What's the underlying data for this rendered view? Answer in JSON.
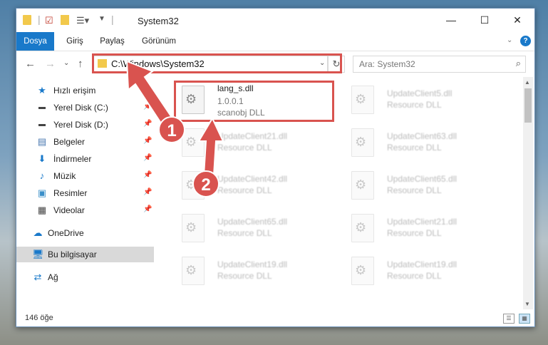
{
  "window": {
    "title": "System32",
    "controls": {
      "minimize": "—",
      "maximize": "☐",
      "close": "✕"
    }
  },
  "ribbon": {
    "tabs": [
      "Dosya",
      "Giriş",
      "Paylaş",
      "Görünüm"
    ]
  },
  "nav": {
    "address": "C:\\Windows\\System32",
    "search_placeholder": "Ara: System32"
  },
  "sidebar": {
    "items": [
      {
        "label": "Hızlı erişim",
        "icon": "star-icon",
        "pinned": false
      },
      {
        "label": "Yerel Disk (C:)",
        "icon": "drive-icon",
        "pinned": true
      },
      {
        "label": "Yerel Disk (D:)",
        "icon": "drive-icon",
        "pinned": true
      },
      {
        "label": "Belgeler",
        "icon": "document-icon",
        "pinned": true
      },
      {
        "label": "İndirmeler",
        "icon": "download-icon",
        "pinned": true
      },
      {
        "label": "Müzik",
        "icon": "music-icon",
        "pinned": true
      },
      {
        "label": "Resimler",
        "icon": "pictures-icon",
        "pinned": true
      },
      {
        "label": "Videolar",
        "icon": "videos-icon",
        "pinned": true
      },
      {
        "label": "OneDrive",
        "icon": "cloud-icon",
        "pinned": false
      },
      {
        "label": "Bu bilgisayar",
        "icon": "computer-icon",
        "pinned": false,
        "selected": true
      },
      {
        "label": "Ağ",
        "icon": "network-icon",
        "pinned": false
      }
    ]
  },
  "files": {
    "highlighted": {
      "name": "lang_s.dll",
      "version": "1.0.0.1",
      "description": "scanobj DLL"
    },
    "left_column": [
      {
        "name": "UpdateClient21.dll",
        "description": "Resource DLL"
      },
      {
        "name": "UpdateClient42.dll",
        "description": "Resource DLL"
      },
      {
        "name": "UpdateClient65.dll",
        "description": "Resource DLL"
      },
      {
        "name": "UpdateClient19.dll",
        "description": "Resource DLL"
      }
    ],
    "right_column": [
      {
        "name": "UpdateClient5.dll",
        "description": "Resource DLL"
      },
      {
        "name": "UpdateClient63.dll",
        "description": "Resource DLL"
      },
      {
        "name": "UpdateClient65.dll",
        "description": "Resource DLL"
      },
      {
        "name": "UpdateClient21.dll",
        "description": "Resource DLL"
      },
      {
        "name": "UpdateClient19.dll",
        "description": "Resource DLL"
      }
    ]
  },
  "status": {
    "item_count": "146 öğe"
  },
  "callouts": [
    "1",
    "2"
  ],
  "colors": {
    "accent": "#1979ca",
    "highlight_red": "#d9534f"
  }
}
